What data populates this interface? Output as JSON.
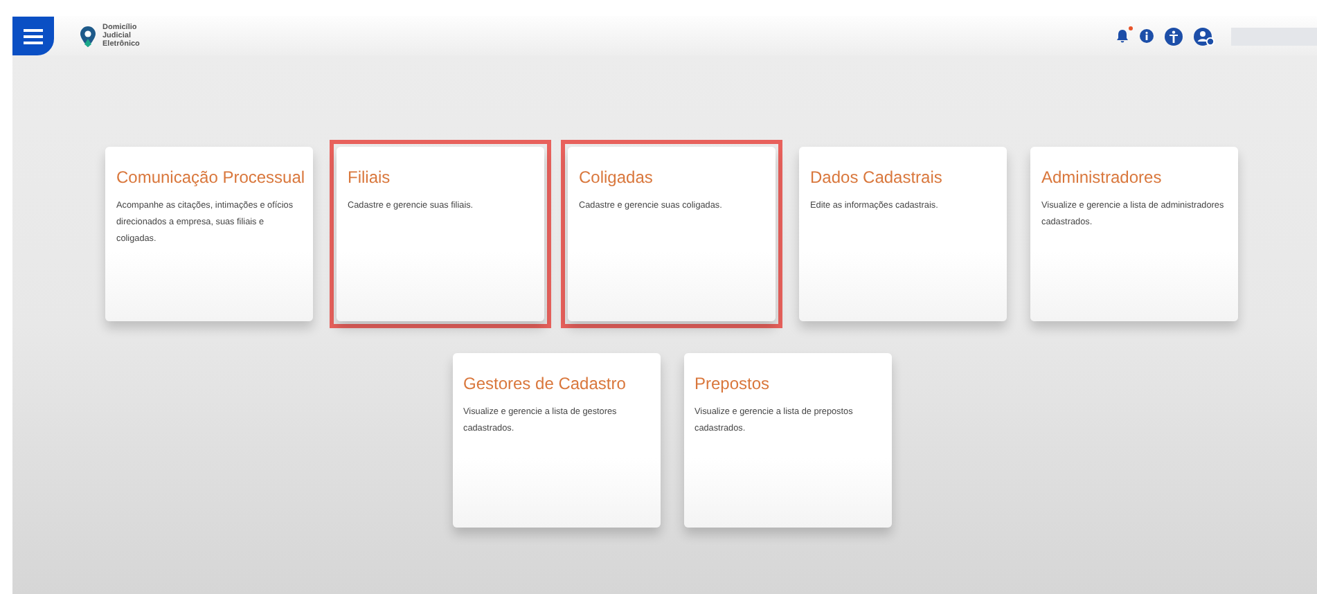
{
  "header": {
    "logo_lines": [
      "Domicílio",
      "Judicial",
      "Eletrônico"
    ],
    "notification_dot": true
  },
  "cards": [
    {
      "title": "Comunicação Processual",
      "description": "Acompanhe as citações, intimações e ofícios direcionados a empresa, suas filiais e coligadas.",
      "highlighted": false
    },
    {
      "title": "Filiais",
      "description": "Cadastre e gerencie suas filiais.",
      "highlighted": true
    },
    {
      "title": "Coligadas",
      "description": "Cadastre e gerencie suas coligadas.",
      "highlighted": true
    },
    {
      "title": "Dados Cadastrais",
      "description": "Edite as informações cadastrais.",
      "highlighted": false
    },
    {
      "title": "Administradores",
      "description": "Visualize e gerencie a lista de administradores cadastrados.",
      "highlighted": false
    },
    {
      "title": "Gestores de Cadastro",
      "description": "Visualize e gerencie a lista de gestores cadastrados.",
      "highlighted": false
    },
    {
      "title": "Prepostos",
      "description": "Visualize e gerencie a lista de prepostos cadastrados.",
      "highlighted": false
    }
  ]
}
